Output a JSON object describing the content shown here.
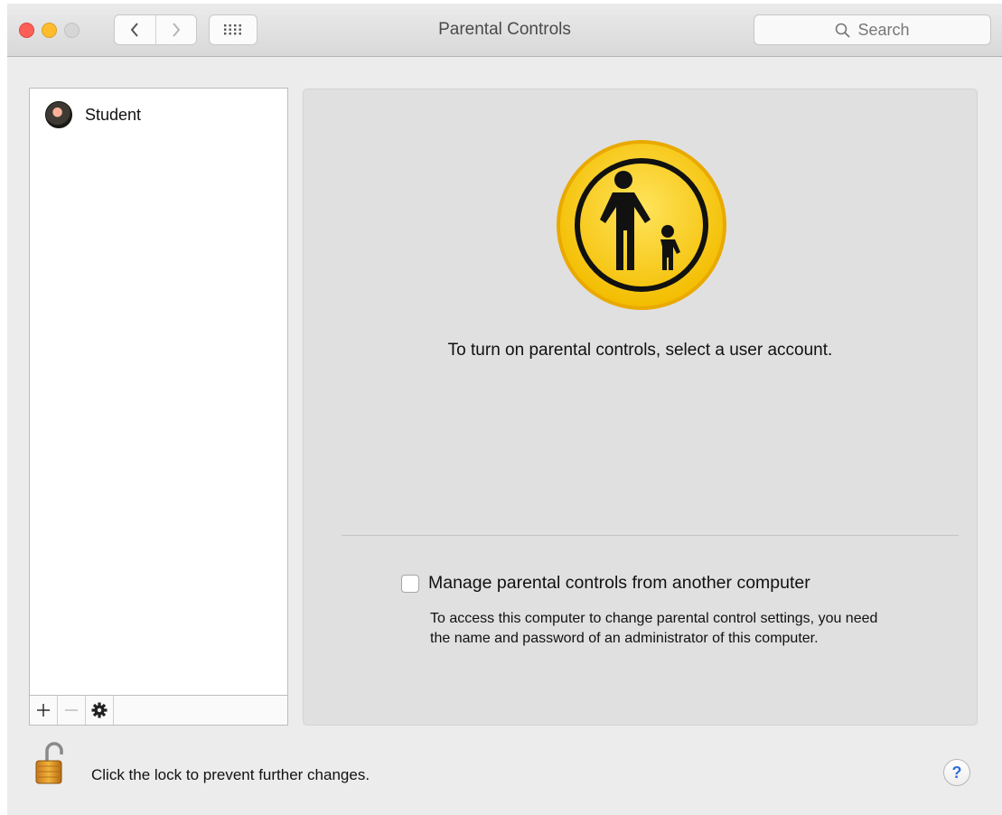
{
  "window": {
    "title": "Parental Controls"
  },
  "toolbar": {
    "back_icon": "chevron-left-icon",
    "forward_icon": "chevron-right-icon",
    "grid_icon": "show-all-grid-icon",
    "search_placeholder": "Search"
  },
  "sidebar": {
    "users": [
      {
        "name": "Student",
        "icon": "user-avatar"
      }
    ],
    "add_icon": "plus-icon",
    "remove_icon": "minus-icon",
    "action_icon": "gear-icon"
  },
  "main": {
    "icon": "parental-controls-icon",
    "instruction": "To turn on parental controls, select a user account.",
    "remote_checkbox": {
      "label": "Manage parental controls from another computer",
      "checked": false
    },
    "remote_help": "To access this computer to change parental control settings, you need the name and password of an administrator of this computer."
  },
  "footer": {
    "lock_state": "unlocked",
    "lock_text": "Click the lock to prevent further changes.",
    "help_label": "?"
  },
  "colors": {
    "close": "#fd5f57",
    "minimize": "#febc2e",
    "zoom": "#d6d6d6",
    "icon_yellow": "#f6c500",
    "help_blue": "#2f6fe0"
  }
}
